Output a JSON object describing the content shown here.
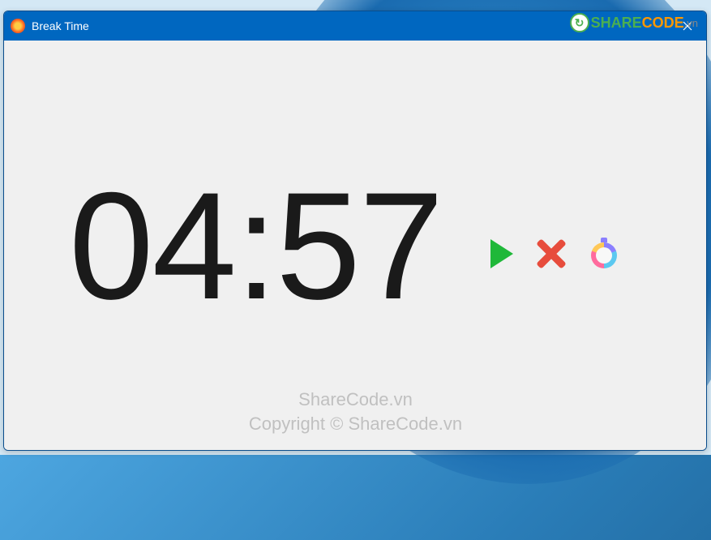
{
  "window": {
    "title": "Break Time"
  },
  "timer": {
    "display": "04:57"
  },
  "watermark": {
    "brand_share": "SHARE",
    "brand_code": "CODE",
    "brand_suffix": ".vn",
    "text1": "ShareCode.vn",
    "text2": "Copyright © ShareCode.vn"
  }
}
